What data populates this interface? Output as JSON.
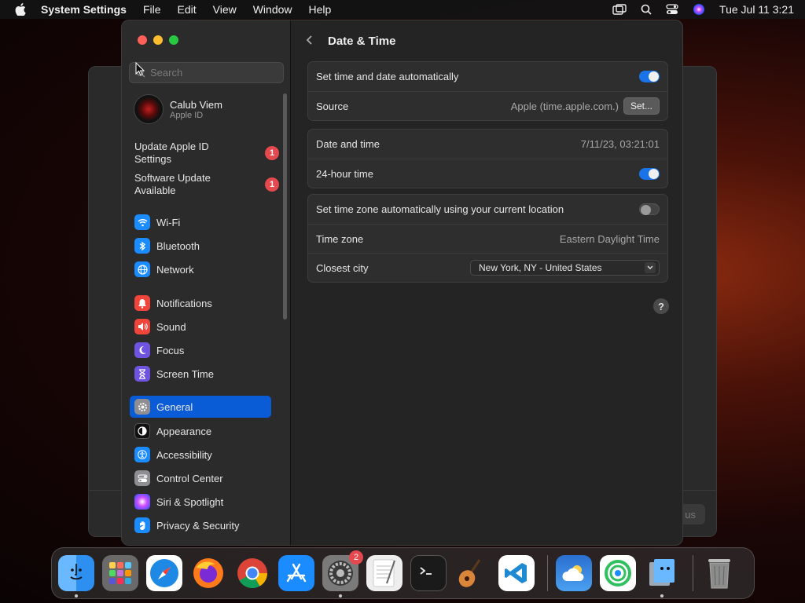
{
  "menubar": {
    "app_name": "System Settings",
    "menus": [
      "File",
      "Edit",
      "View",
      "Window",
      "Help"
    ],
    "clock": "Tue Jul 11  3:21"
  },
  "background_window": {
    "button_label": "us"
  },
  "sidebar": {
    "search_placeholder": "Search",
    "profile": {
      "name": "Calub Viem",
      "subtitle": "Apple ID"
    },
    "updates": [
      {
        "label": "Update Apple ID Settings",
        "badge": "1"
      },
      {
        "label": "Software Update Available",
        "badge": "1"
      }
    ],
    "items": [
      {
        "label": "Wi-Fi",
        "icon": "wifi-icon",
        "color": "#1a8cff"
      },
      {
        "label": "Bluetooth",
        "icon": "bluetooth-icon",
        "color": "#1a8cff"
      },
      {
        "label": "Network",
        "icon": "globe-icon",
        "color": "#1a8cff"
      },
      {
        "label": "Notifications",
        "icon": "bell-icon",
        "color": "#f0453a"
      },
      {
        "label": "Sound",
        "icon": "speaker-icon",
        "color": "#f0453a"
      },
      {
        "label": "Focus",
        "icon": "moon-icon",
        "color": "#6e54e0"
      },
      {
        "label": "Screen Time",
        "icon": "hourglass-icon",
        "color": "#6e54e0"
      },
      {
        "label": "General",
        "icon": "gear-icon",
        "color": "#8e8e93",
        "active": true
      },
      {
        "label": "Appearance",
        "icon": "appearance-icon",
        "color": "#111111"
      },
      {
        "label": "Accessibility",
        "icon": "accessibility-icon",
        "color": "#1a8cff"
      },
      {
        "label": "Control Center",
        "icon": "control-center-icon",
        "color": "#8e8e93"
      },
      {
        "label": "Siri & Spotlight",
        "icon": "siri-icon",
        "color": "#c040c0"
      },
      {
        "label": "Privacy & Security",
        "icon": "hand-icon",
        "color": "#1a8cff"
      }
    ]
  },
  "content": {
    "title": "Date & Time",
    "group1": {
      "auto_label": "Set time and date automatically",
      "auto_on": true,
      "source_label": "Source",
      "source_value": "Apple (time.apple.com.)",
      "set_button": "Set..."
    },
    "group2": {
      "datetime_label": "Date and time",
      "datetime_value": "7/11/23, 03:21:01",
      "h24_label": "24-hour time",
      "h24_on": true
    },
    "group3": {
      "tz_auto_label": "Set time zone automatically using your current location",
      "tz_auto_on": false,
      "tz_label": "Time zone",
      "tz_value": "Eastern Daylight Time",
      "city_label": "Closest city",
      "city_value": "New York, NY - United States"
    },
    "help": "?"
  },
  "dock": {
    "settings_badge": "2",
    "colors": {
      "finder": "#2d8ff0",
      "launchpad": "#8a8a8a",
      "safari": "#1e88e5",
      "firefox": "#ff7a1a",
      "chrome": "#ffffff",
      "appstore": "#1a8cff",
      "settings": "#7a7a7a",
      "textedit": "#eeeeee",
      "terminal": "#1a1a1a",
      "garageband": "#d9863a",
      "vscode": "#1f8ad2",
      "weather": "#3a8ee8",
      "findmy": "#30c060",
      "preview": "#9aa8b8",
      "trash": "#8c8c8c"
    }
  }
}
